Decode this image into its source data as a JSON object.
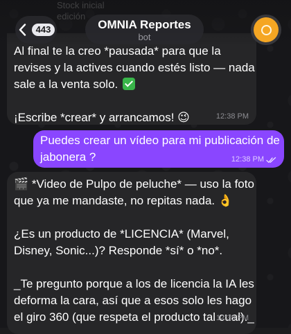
{
  "header": {
    "back_badge": "443",
    "title": "OMNIA Reportes",
    "subtitle": "bot",
    "pinned_ghost_line1": "Stock inicial",
    "pinned_ghost_line2": "edición"
  },
  "messages": [
    {
      "direction": "incoming",
      "lines": [
        "Al final te la creo *pausada* para que la",
        "revises y la actives cuando estés listo — nada",
        "sale a la venta solo.",
        "",
        "¡Escribe *crear* y arrancamos! 😉"
      ],
      "time": "12:38 PM"
    },
    {
      "direction": "outgoing",
      "lines": [
        "Puedes crear un vídeo para mi publicación de",
        "jabonera ?"
      ],
      "time": "12:38 PM",
      "status": "read"
    },
    {
      "direction": "incoming",
      "lines": [
        "🎬 *Video de Pulpo de peluche* — uso la foto",
        "que ya me mandaste, no repitas nada. 👌",
        "",
        "¿Es un producto de *LICENCIA* (Marvel,",
        "Disney, Sonic...)? Responde *sí* o *no*.",
        "",
        "_Te pregunto porque a los de licencia la IA les",
        "deforma la cara, así que a esos solo les hago",
        "el giro 360 (que respeta el producto tal cual)._"
      ],
      "time": "12:38 PM"
    }
  ],
  "colors": {
    "outgoing_bubble": "#8a46ff",
    "incoming_bubble": "#262628",
    "avatar": "#f5a623",
    "background": "#17171a"
  },
  "icons": {
    "back": "chevron-left-icon",
    "read_status": "double-check-icon",
    "emoji_check": "check-mark-button-icon"
  }
}
